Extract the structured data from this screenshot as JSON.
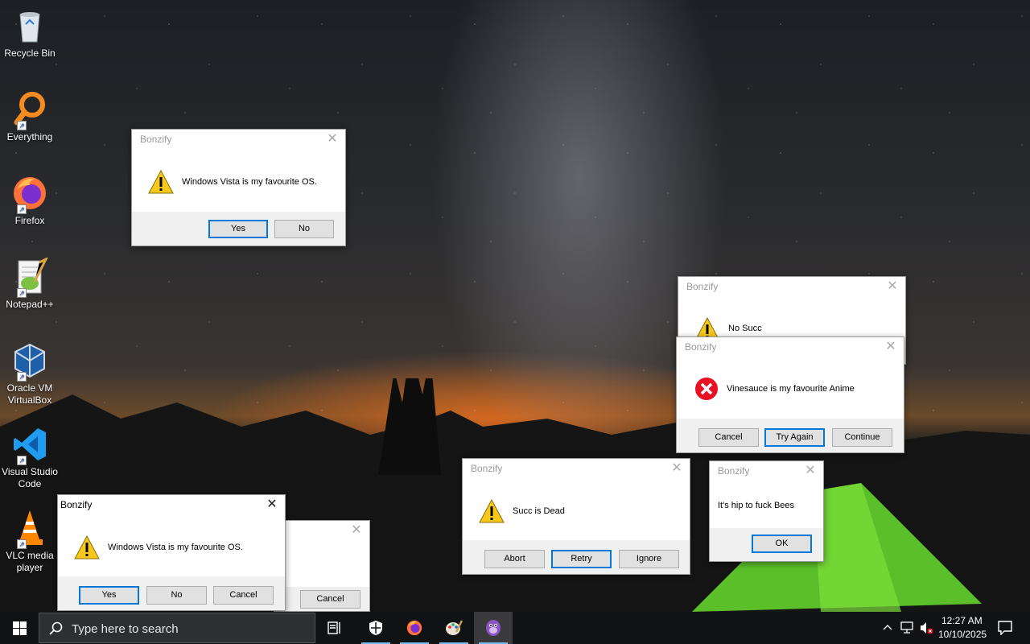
{
  "desktop_icons": [
    {
      "label": "Recycle Bin",
      "icon": "recycle-bin-icon"
    },
    {
      "label": "Everything",
      "icon": "everything-search-icon"
    },
    {
      "label": "Firefox",
      "icon": "firefox-icon"
    },
    {
      "label": "Notepad++",
      "icon": "notepad-plus-plus-icon"
    },
    {
      "label_line1": "Oracle VM",
      "label_line2": "VirtualBox",
      "icon": "virtualbox-icon"
    },
    {
      "label_line1": "Visual Studio",
      "label_line2": "Code",
      "icon": "vscode-icon"
    },
    {
      "label_line1": "VLC media",
      "label_line2": "player",
      "icon": "vlc-icon"
    }
  ],
  "dialogs": {
    "vista_top": {
      "title": "Bonzify",
      "message": "Windows Vista is my favourite OS.",
      "buttons": [
        "Yes",
        "No"
      ],
      "icon": "warning-icon"
    },
    "no_succ": {
      "title": "Bonzify",
      "message": "No Succ",
      "icon": "warning-icon"
    },
    "vinesauce": {
      "title": "Bonzify",
      "message": "Vinesauce is my favourite Anime",
      "buttons": [
        "Cancel",
        "Try Again",
        "Continue"
      ],
      "icon": "error-icon"
    },
    "succ_dead": {
      "title": "Bonzify",
      "message": "Succ is Dead",
      "buttons": [
        "Abort",
        "Retry",
        "Ignore"
      ],
      "icon": "warning-icon"
    },
    "hip_bees": {
      "title": "Bonzify",
      "message": "It's hip to fuck Bees",
      "buttons": [
        "OK"
      ]
    },
    "behind_cancel": {
      "buttons": [
        "Cancel"
      ]
    },
    "vista_bottom": {
      "title": "Bonzify",
      "message": "Windows Vista is my favourite OS.",
      "buttons": [
        "Yes",
        "No",
        "Cancel"
      ],
      "icon": "warning-icon"
    }
  },
  "taskbar": {
    "search_placeholder": "Type here to search",
    "pinned": [
      "start-windows-icon",
      "task-view-icon",
      "windows-security-icon",
      "firefox-icon",
      "paint-icon",
      "bonzibuddy-icon"
    ],
    "time": "12:27 AM",
    "date": "10/10/2025"
  },
  "colors": {
    "taskbar": "#111213",
    "accent": "#0078d7",
    "dialog_footer": "#f0f0f0"
  }
}
